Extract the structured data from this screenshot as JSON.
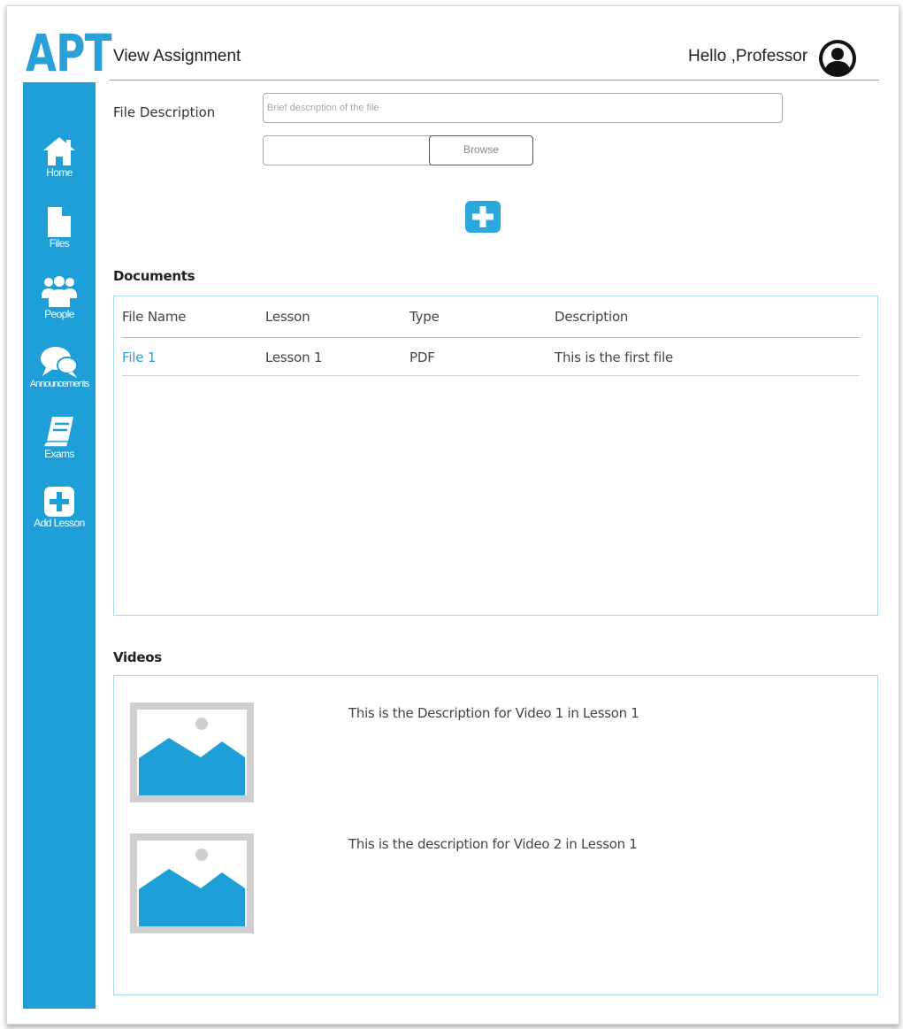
{
  "app": {
    "logo_text": "APT",
    "page_title": "View Assignment",
    "greeting": "Hello ,Professor",
    "avatar_icon": "user-circle-icon",
    "accent_color": "#1e9fd8"
  },
  "sidebar": {
    "items": [
      {
        "label": "Home",
        "icon": "home-icon"
      },
      {
        "label": "Files",
        "icon": "file-icon"
      },
      {
        "label": "People",
        "icon": "people-icon"
      },
      {
        "label": "Announcements",
        "icon": "chat-bubbles-icon"
      },
      {
        "label": "Exams",
        "icon": "book-icon"
      },
      {
        "label": "Add Lesson",
        "icon": "plus-square-icon"
      }
    ]
  },
  "upload": {
    "description_label": "File Description",
    "description_placeholder": "Brief description of the file",
    "description_value": "",
    "browse_label": "Browse",
    "add_icon": "plus-square-icon"
  },
  "documents": {
    "title": "Documents",
    "columns": [
      "File Name",
      "Lesson",
      "Type",
      "Description"
    ],
    "rows": [
      {
        "file_name": "File 1",
        "lesson": "Lesson 1",
        "type": "PDF",
        "description": "This is the first file"
      }
    ]
  },
  "videos": {
    "title": "Videos",
    "items": [
      {
        "thumbnail_icon": "image-placeholder-icon",
        "description": "This is the Description for Video 1 in Lesson 1"
      },
      {
        "thumbnail_icon": "image-placeholder-icon",
        "description": "This is the description for Video 2 in Lesson 1"
      }
    ]
  }
}
